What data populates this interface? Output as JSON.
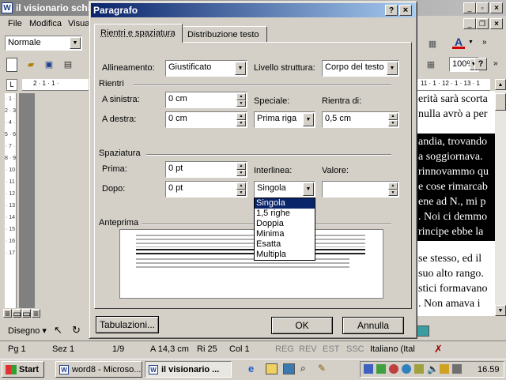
{
  "word": {
    "title": "il visionario schi",
    "menus": [
      "File",
      "Modifica",
      "Visua"
    ],
    "style_box": "Normale",
    "zoom": "100%",
    "doc_lines_top": [
      "erità sarà scorta",
      "nulla avrò a per"
    ],
    "doc_lines_selected": [
      "andia, trovando",
      "a soggiornava. ",
      "rinnovammo qu",
      "e cose rimarcab",
      "ene ad N., mi p",
      ". Noi ci demmo",
      "rincipe ebbe la"
    ],
    "doc_lines_bottom": [
      "se stesso, ed il",
      "suo alto rango.",
      "stici formavano",
      ". Non amava i"
    ],
    "drawing_label": "Disegno",
    "status": {
      "page": "Pg 1",
      "section": "Sez 1",
      "pages": "1/9",
      "at": "A 14,3 cm",
      "line": "Ri 25",
      "col": "Col 1",
      "rec": "REG",
      "rev": "REV",
      "ext": "EST",
      "ovr": "SSC",
      "language": "Italiano (Ital"
    }
  },
  "dialog": {
    "title": "Paragrafo",
    "tabs": [
      "Rientri e spaziatura",
      "Distribuzione testo"
    ],
    "alignment_label": "Allineamento:",
    "alignment_value": "Giustificato",
    "outline_label": "Livello struttura:",
    "outline_value": "Corpo del testo",
    "indent_group": "Rientri",
    "left_label": "A sinistra:",
    "left_value": "0 cm",
    "right_label": "A destra:",
    "right_value": "0 cm",
    "special_label": "Speciale:",
    "special_value": "Prima riga",
    "indent_by_label": "Rientra di:",
    "indent_by_value": "0,5 cm",
    "spacing_group": "Spaziatura",
    "before_label": "Prima:",
    "before_value": "0 pt",
    "after_label": "Dopo:",
    "after_value": "0 pt",
    "line_spacing_label": "Interlinea:",
    "line_spacing_value": "Singola",
    "at_label": "Valore:",
    "at_value": "",
    "line_spacing_options": [
      "Singola",
      "1,5 righe",
      "Doppia",
      "Minima",
      "Esatta",
      "Multipla"
    ],
    "preview_group": "Anteprima",
    "tabs_button": "Tabulazioni...",
    "ok_button": "OK",
    "cancel_button": "Annulla"
  },
  "taskbar": {
    "start": "Start",
    "tasks": [
      "word8 - Microso...",
      "il visionario ..."
    ],
    "clock": "16.59"
  },
  "colors": {
    "title_active": "#0a246a",
    "selection": "#0a246a",
    "face": "#d4d0c8"
  }
}
